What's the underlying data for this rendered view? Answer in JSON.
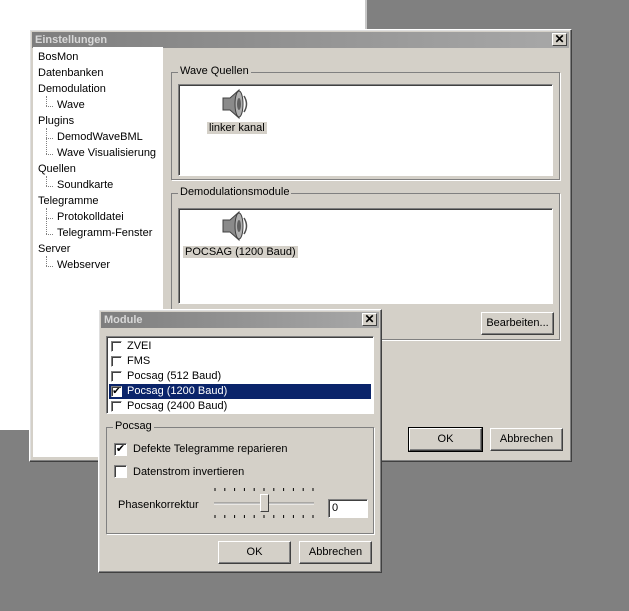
{
  "settings": {
    "title": "Einstellungen",
    "tree": [
      {
        "label": "BosMon",
        "level": 0
      },
      {
        "label": "Datenbanken",
        "level": 0
      },
      {
        "label": "Demodulation",
        "level": 0
      },
      {
        "label": "Wave",
        "level": 1
      },
      {
        "label": "Plugins",
        "level": 0
      },
      {
        "label": "DemodWaveBML",
        "level": 1
      },
      {
        "label": "Wave Visualisierung",
        "level": 1
      },
      {
        "label": "Quellen",
        "level": 0
      },
      {
        "label": "Soundkarte",
        "level": 1
      },
      {
        "label": "Telegramme",
        "level": 0
      },
      {
        "label": "Protokolldatei",
        "level": 1
      },
      {
        "label": "Telegramm-Fenster",
        "level": 1
      },
      {
        "label": "Server",
        "level": 0
      },
      {
        "label": "Webserver",
        "level": 1
      }
    ],
    "wave_sources": {
      "group_label": "Wave Quellen",
      "items": [
        {
          "label": "linker kanal",
          "icon": "speaker-icon"
        }
      ]
    },
    "demod_modules": {
      "group_label": "Demodulationsmodule",
      "items": [
        {
          "label": "POCSAG (1200 Baud)",
          "icon": "speaker-icon"
        }
      ],
      "edit_button": "Bearbeiten..."
    },
    "ok_button": "OK",
    "cancel_button": "Abbrechen"
  },
  "modules": {
    "title": "Module",
    "list": [
      {
        "label": "ZVEI",
        "checked": false,
        "selected": false
      },
      {
        "label": "FMS",
        "checked": false,
        "selected": false
      },
      {
        "label": "Pocsag (512 Baud)",
        "checked": false,
        "selected": false
      },
      {
        "label": "Pocsag (1200 Baud)",
        "checked": true,
        "selected": true
      },
      {
        "label": "Pocsag (2400 Baud)",
        "checked": false,
        "selected": false
      }
    ],
    "pocsag": {
      "group_label": "Pocsag",
      "repair_label": "Defekte Telegramme reparieren",
      "repair_checked": true,
      "invert_label": "Datenstrom invertieren",
      "invert_checked": false,
      "phase_label": "Phasenkorrektur",
      "phase_value": "0",
      "slider_fraction": 0.5
    },
    "ok_button": "OK",
    "cancel_button": "Abbrechen"
  }
}
